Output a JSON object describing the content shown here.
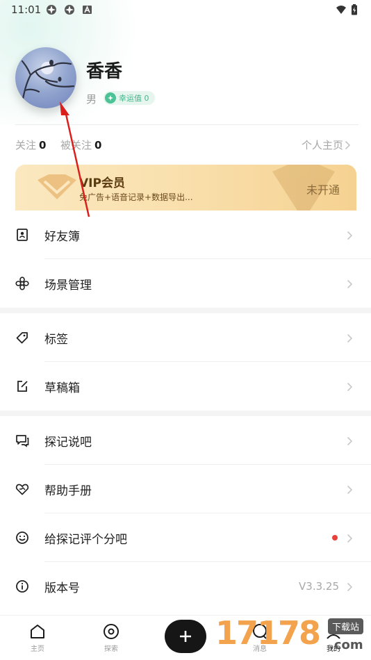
{
  "status_bar": {
    "time": "11:01"
  },
  "profile": {
    "nickname": "香香",
    "gender": "男",
    "luck_label": "幸运值 0"
  },
  "follow": {
    "following_label": "关注",
    "following_count": "0",
    "followers_label": "被关注",
    "followers_count": "0",
    "homepage_label": "个人主页"
  },
  "vip": {
    "title": "VIP会员",
    "description": "免广告+语音记录+数据导出...",
    "status": "未开通"
  },
  "menu": {
    "friends": "好友簿",
    "scenes": "场景管理",
    "tags": "标签",
    "drafts": "草稿箱",
    "talk": "探记说吧",
    "help": "帮助手册",
    "rate": "给探记评个分吧",
    "version_label": "版本号",
    "version_value": "V3.3.25"
  },
  "bottom_nav": {
    "home": "主页",
    "explore": "探索",
    "messages": "消息",
    "mine": "我的"
  },
  "watermark": {
    "digits": "17178",
    "site": "下载站",
    "domain": ".com"
  },
  "colors": {
    "accent": "#4cc296",
    "vip_bg": "#f9dfac",
    "red_dot": "#e8413b"
  }
}
